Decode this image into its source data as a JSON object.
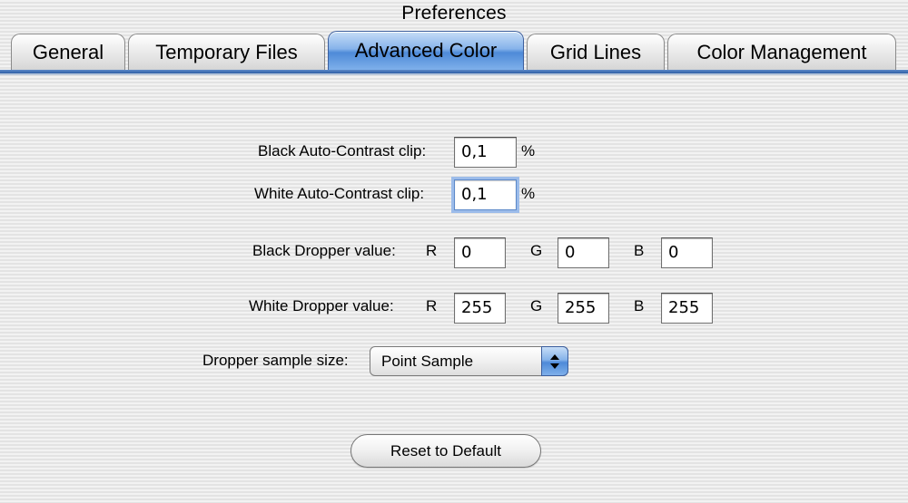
{
  "window": {
    "title": "Preferences"
  },
  "tabs": [
    {
      "label": "General"
    },
    {
      "label": "Temporary Files"
    },
    {
      "label": "Advanced Color"
    },
    {
      "label": "Grid Lines"
    },
    {
      "label": "Color Management"
    }
  ],
  "active_tab": "Advanced Color",
  "auto_contrast": {
    "black_label": "Black Auto-Contrast clip:",
    "black_value": "0,1",
    "white_label": "White Auto-Contrast clip:",
    "white_value": "0,1",
    "unit": "%"
  },
  "black_dropper": {
    "label": "Black Dropper value:",
    "r_label": "R",
    "r_value": "0",
    "g_label": "G",
    "g_value": "0",
    "b_label": "B",
    "b_value": "0"
  },
  "white_dropper": {
    "label": "White Dropper value:",
    "r_label": "R",
    "r_value": "255",
    "g_label": "G",
    "g_value": "255",
    "b_label": "B",
    "b_value": "255"
  },
  "sample_size": {
    "label": "Dropper sample size:",
    "selected": "Point Sample"
  },
  "reset_button": {
    "label": "Reset to Default"
  },
  "colors": {
    "accent": "#4e8ad8",
    "focus_ring": "#9cbcea"
  }
}
